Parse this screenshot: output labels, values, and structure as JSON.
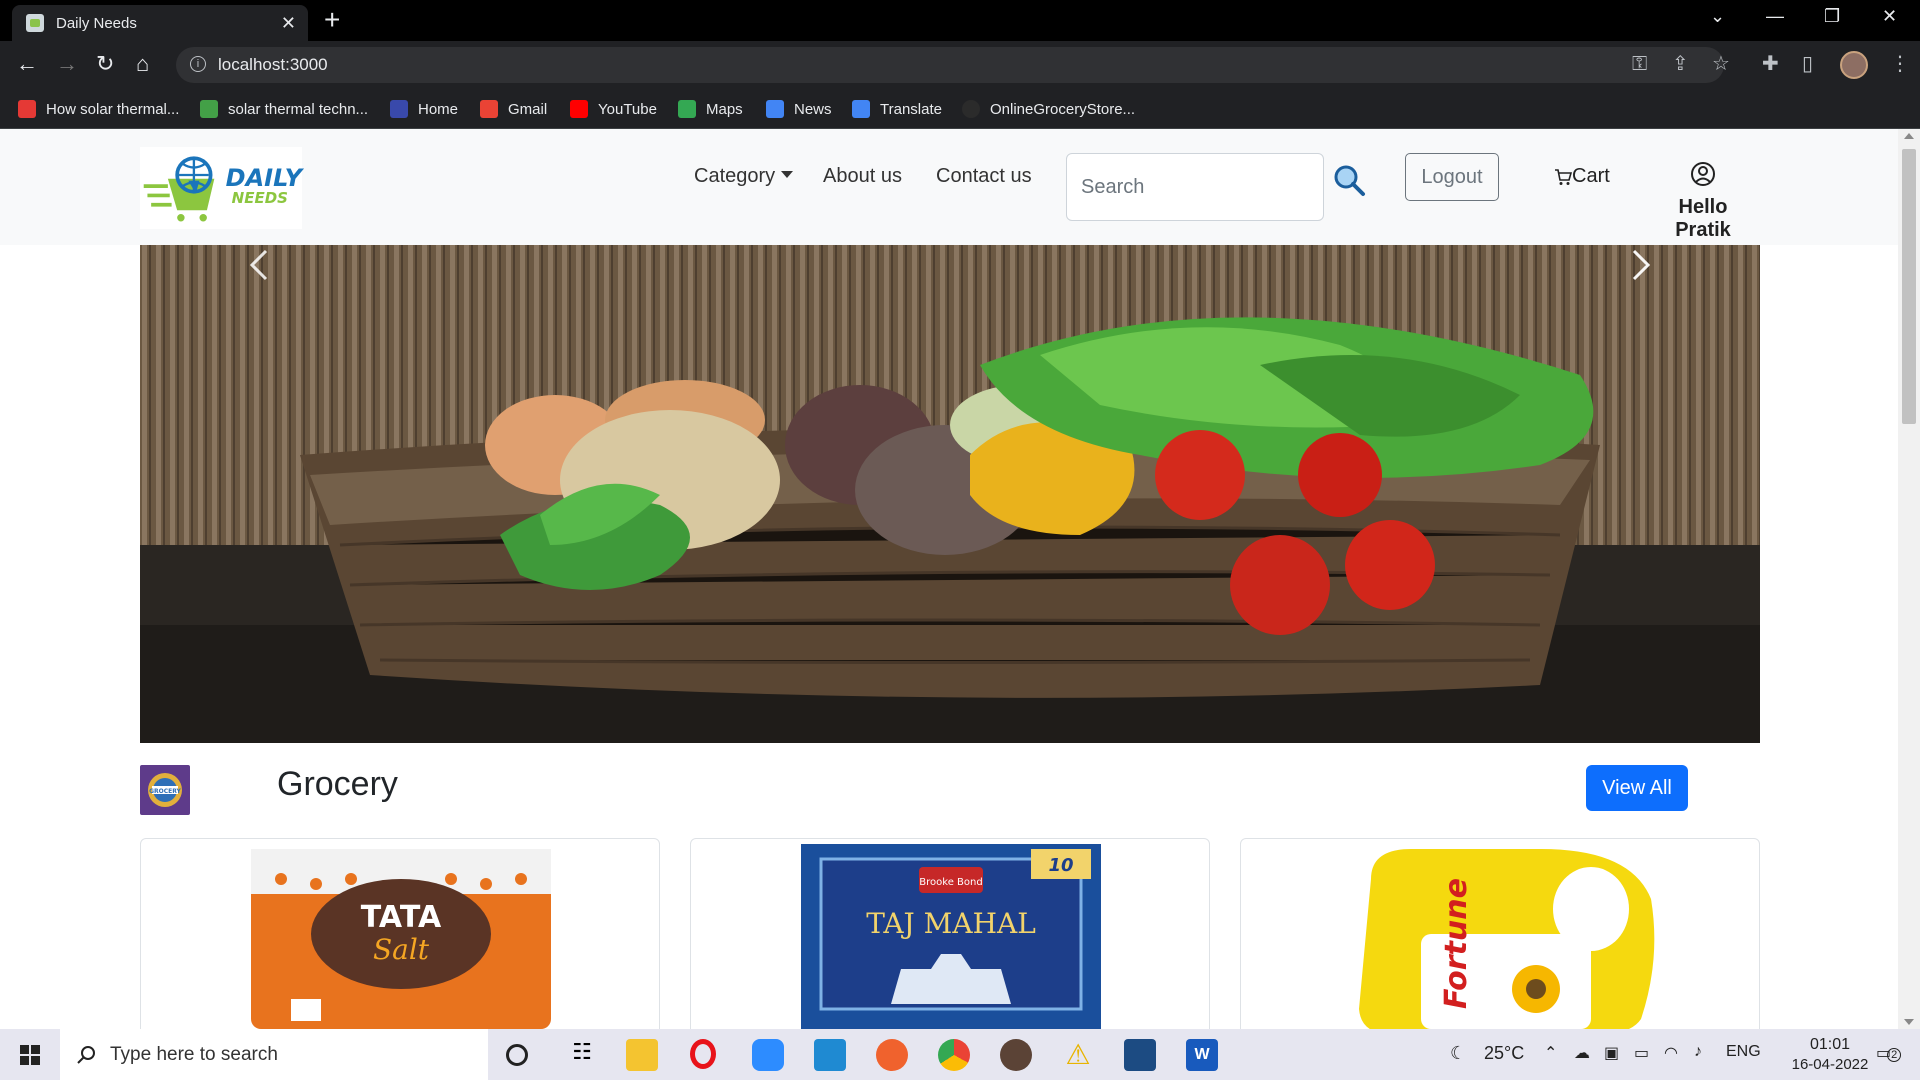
{
  "browser": {
    "tab_title": "Daily Needs",
    "tab_close": "✕",
    "new_tab": "+",
    "url": "localhost:3000",
    "bookmarks": [
      {
        "label": "How solar thermal...",
        "color": "#e53935"
      },
      {
        "label": "solar thermal techn...",
        "color": "#43a047"
      },
      {
        "label": "Home",
        "color": "#3949ab"
      },
      {
        "label": "Gmail",
        "color": "#ea4335"
      },
      {
        "label": "YouTube",
        "color": "#ff0000"
      },
      {
        "label": "Maps",
        "color": "#34a853"
      },
      {
        "label": "News",
        "color": "#4285f4"
      },
      {
        "label": "Translate",
        "color": "#4285f4"
      },
      {
        "label": "OnlineGroceryStore...",
        "color": "#2b2b2b"
      }
    ]
  },
  "site": {
    "logo": {
      "line1": "DAILY",
      "line2": "NEEDS"
    },
    "nav": {
      "category": "Category",
      "about": "About us",
      "contact": "Contact us"
    },
    "search_placeholder": "Search",
    "logout_label": "Logout",
    "cart_label": "Cart",
    "user_greeting": "Hello Pratik"
  },
  "section": {
    "title": "Grocery",
    "view_all_label": "View All",
    "icon_badge": "GROCERY"
  },
  "products": [
    {
      "brand": "TATA",
      "name": "Salt"
    },
    {
      "brand": "Brooke Bond",
      "name": "TAJ MAHAL",
      "badge": "10"
    },
    {
      "brand": "Fortune",
      "name": "Fortune"
    }
  ],
  "taskbar": {
    "search_placeholder": "Type here to search",
    "weather": "25°C",
    "lang": "ENG",
    "time": "01:01",
    "date": "16-04-2022",
    "notif_count": "2"
  },
  "colors": {
    "primary": "#0d6efd",
    "navbar_bg": "#f8f9fa",
    "logo_blue": "#1b75bb",
    "logo_green": "#8cc63f"
  }
}
